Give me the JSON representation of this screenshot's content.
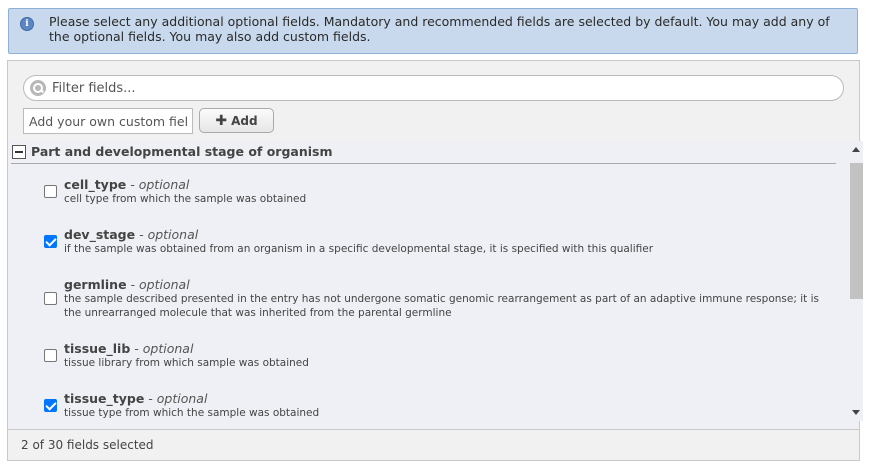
{
  "info": {
    "icon": "info-icon",
    "text": "Please select any additional optional fields. Mandatory and recommended fields are selected by default. You may add any of the optional fields. You may also add custom fields."
  },
  "filter": {
    "placeholder": "Filter fields...",
    "value": ""
  },
  "custom": {
    "placeholder": "Add your own custom field",
    "value": "",
    "add_label": "Add"
  },
  "group": {
    "title": "Part and developmental stage of organism",
    "fields": [
      {
        "name": "cell_type",
        "tag": " - optional",
        "checked": false,
        "desc": "cell type from which the sample was obtained"
      },
      {
        "name": "dev_stage",
        "tag": " - optional",
        "checked": true,
        "desc": "if the sample was obtained from an organism in a specific developmental stage, it is specified with this qualifier"
      },
      {
        "name": "germline",
        "tag": " - optional",
        "checked": false,
        "desc": "the sample described presented in the entry has not undergone somatic genomic rearrangement as part of an adaptive immune response; it is the unrearranged molecule that was inherited from the parental germline"
      },
      {
        "name": "tissue_lib",
        "tag": " - optional",
        "checked": false,
        "desc": "tissue library from which sample was obtained"
      },
      {
        "name": "tissue_type",
        "tag": " - optional",
        "checked": true,
        "desc": "tissue type from which the sample was obtained"
      }
    ]
  },
  "footer": {
    "status": "2  of  30  fields selected"
  },
  "colors": {
    "info_bg": "#c8d9ed",
    "checkbox_checked": "#0075ff",
    "panel_bg": "#f1f1f1"
  }
}
